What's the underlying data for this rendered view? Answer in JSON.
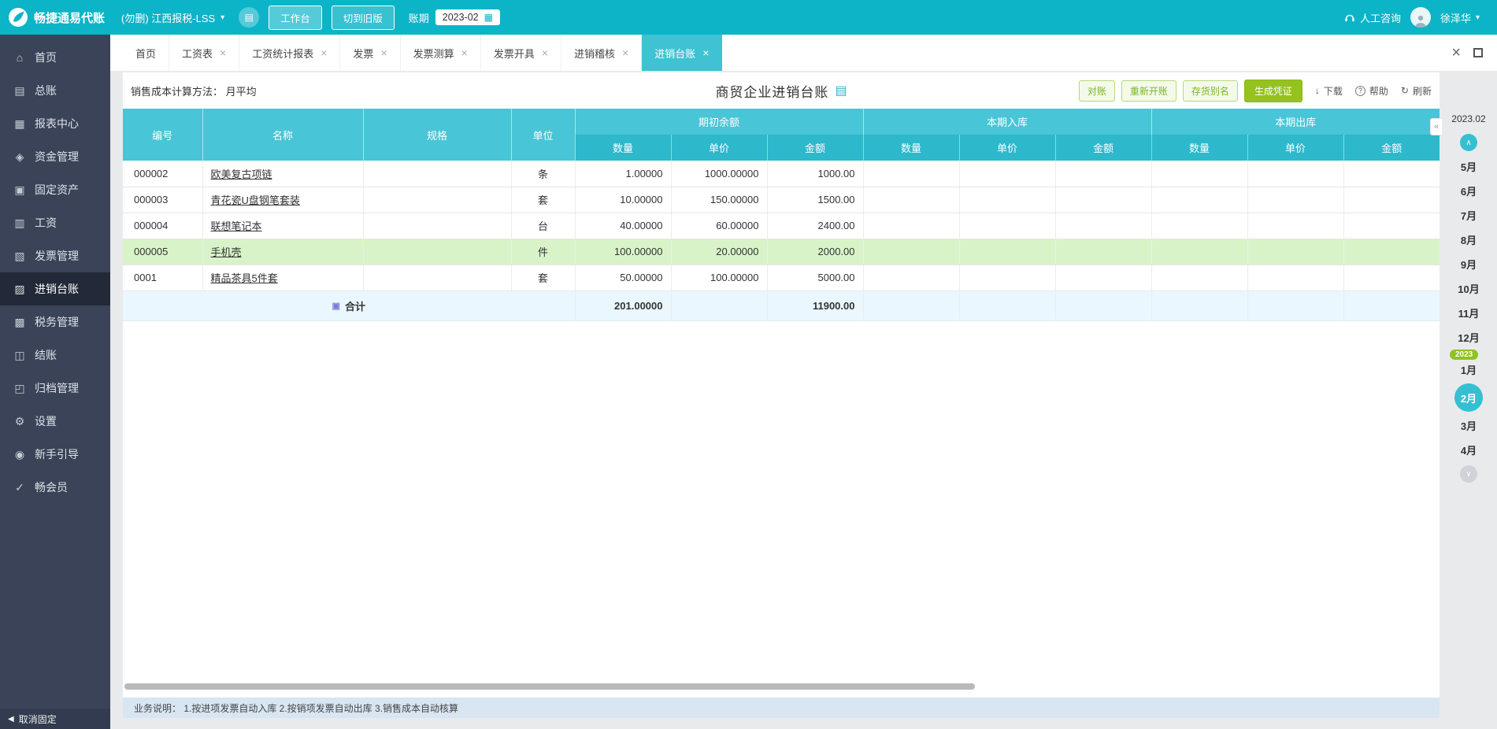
{
  "colors": {
    "accent_cyan": "#0cb4c7",
    "table_header_cyan": "#48c5d6",
    "table_subheader_cyan": "#2db8cc",
    "primary_green": "#95c21e",
    "highlight_row_green": "#d9f3c9",
    "total_row_blue": "#eaf7fe",
    "sidebar_dark": "#3a4357",
    "statusbar_blue": "#d8e5f2"
  },
  "topbar": {
    "logo_text": "畅捷通易代账",
    "company_select": "(勿删) 江西报税-LSS",
    "workbench_button": "工作台",
    "switch_old_button": "切到旧版",
    "period_label": "账期",
    "period_value": "2023-02",
    "consult_label": "人工咨询",
    "user_name": "徐泽华"
  },
  "sidebar": {
    "items": [
      {
        "id": "home",
        "label": "首页",
        "icon": "home-icon",
        "glyph": "⌂",
        "active": false
      },
      {
        "id": "general-ledger",
        "label": "总账",
        "icon": "ledger-icon",
        "glyph": "▤",
        "active": false
      },
      {
        "id": "report-center",
        "label": "报表中心",
        "icon": "report-icon",
        "glyph": "▦",
        "active": false
      },
      {
        "id": "funds",
        "label": "资金管理",
        "icon": "funds-icon",
        "glyph": "◈",
        "active": false
      },
      {
        "id": "fixed-assets",
        "label": "固定资产",
        "icon": "fixed-assets-icon",
        "glyph": "▣",
        "active": false
      },
      {
        "id": "payroll",
        "label": "工资",
        "icon": "payroll-icon",
        "glyph": "▥",
        "active": false
      },
      {
        "id": "invoice-mgmt",
        "label": "发票管理",
        "icon": "invoice-icon",
        "glyph": "▧",
        "active": false
      },
      {
        "id": "purchase-sale-ledger",
        "label": "进销台账",
        "icon": "inventory-ledger-icon",
        "glyph": "▨",
        "active": true
      },
      {
        "id": "tax-mgmt",
        "label": "税务管理",
        "icon": "tax-icon",
        "glyph": "▩",
        "active": false
      },
      {
        "id": "closing",
        "label": "结账",
        "icon": "closing-icon",
        "glyph": "◫",
        "active": false
      },
      {
        "id": "archive-mgmt",
        "label": "归档管理",
        "icon": "archive-icon",
        "glyph": "◰",
        "active": false
      },
      {
        "id": "settings",
        "label": "设置",
        "icon": "gear-icon",
        "glyph": "⚙",
        "active": false
      },
      {
        "id": "beginner-guide",
        "label": "新手引导",
        "icon": "guide-icon",
        "glyph": "◉",
        "active": false
      },
      {
        "id": "member",
        "label": "畅会员",
        "icon": "member-icon",
        "glyph": "✓",
        "active": false
      }
    ],
    "unpin_label": "取消固定"
  },
  "tabs": [
    {
      "id": "home",
      "label": "首页",
      "closable": false,
      "active": false
    },
    {
      "id": "payroll-sheet",
      "label": "工资表",
      "closable": true,
      "active": false
    },
    {
      "id": "payroll-stat-report",
      "label": "工资统计报表",
      "closable": true,
      "active": false
    },
    {
      "id": "invoice",
      "label": "发票",
      "closable": true,
      "active": false
    },
    {
      "id": "invoice-calc",
      "label": "发票测算",
      "closable": true,
      "active": false
    },
    {
      "id": "invoice-issue",
      "label": "发票开具",
      "closable": true,
      "active": false
    },
    {
      "id": "purchase-sale-audit",
      "label": "进销稽核",
      "closable": true,
      "active": false
    },
    {
      "id": "purchase-sale-ledger",
      "label": "进销台账",
      "closable": true,
      "active": true
    }
  ],
  "toolbar": {
    "cost_method_label": "销售成本计算方法：",
    "cost_method_value": "月平均",
    "page_title": "商贸企业进销台账",
    "buttons": [
      "对账",
      "重新开账",
      "存货别名"
    ],
    "primary_button": "生成凭证",
    "download_label": "下载",
    "help_label": "帮助",
    "refresh_label": "刷新"
  },
  "table": {
    "columns": [
      "编号",
      "名称",
      "规格",
      "单位"
    ],
    "groups": [
      "期初余额",
      "本期入库",
      "本期出库"
    ],
    "subcolumns": [
      "数量",
      "单价",
      "金额"
    ],
    "rows": [
      {
        "code": "000002",
        "name": "欧美复古项链",
        "spec": "",
        "unit": "条",
        "qty": "1.00000",
        "price": "1000.00000",
        "amount": "1000.00",
        "in_qty": "",
        "in_price": "",
        "in_amount": "",
        "out_qty": "",
        "out_price": "",
        "out_amount": "",
        "highlight": false
      },
      {
        "code": "000003",
        "name": "青花瓷U盘钢笔套装",
        "spec": "",
        "unit": "套",
        "qty": "10.00000",
        "price": "150.00000",
        "amount": "1500.00",
        "in_qty": "",
        "in_price": "",
        "in_amount": "",
        "out_qty": "",
        "out_price": "",
        "out_amount": "",
        "highlight": false
      },
      {
        "code": "000004",
        "name": "联想笔记本",
        "spec": "",
        "unit": "台",
        "qty": "40.00000",
        "price": "60.00000",
        "amount": "2400.00",
        "in_qty": "",
        "in_price": "",
        "in_amount": "",
        "out_qty": "",
        "out_price": "",
        "out_amount": "",
        "highlight": false
      },
      {
        "code": "000005",
        "name": "手机壳",
        "spec": "",
        "unit": "件",
        "qty": "100.00000",
        "price": "20.00000",
        "amount": "2000.00",
        "in_qty": "",
        "in_price": "",
        "in_amount": "",
        "out_qty": "",
        "out_price": "",
        "out_amount": "",
        "highlight": true
      },
      {
        "code": "0001",
        "name": "精品茶具5件套",
        "spec": "",
        "unit": "套",
        "qty": "50.00000",
        "price": "100.00000",
        "amount": "5000.00",
        "in_qty": "",
        "in_price": "",
        "in_amount": "",
        "out_qty": "",
        "out_price": "",
        "out_amount": "",
        "highlight": false
      }
    ],
    "total": {
      "label": "合计",
      "qty": "201.00000",
      "amount": "11900.00"
    }
  },
  "month_panel": {
    "current": "2023.02",
    "items": [
      {
        "label": "5月"
      },
      {
        "label": "6月"
      },
      {
        "label": "7月"
      },
      {
        "label": "8月"
      },
      {
        "label": "9月"
      },
      {
        "label": "10月"
      },
      {
        "label": "11月"
      },
      {
        "label": "12月"
      },
      {
        "label": "2023",
        "badge": true
      },
      {
        "label": "1月"
      },
      {
        "label": "2月",
        "active": true
      },
      {
        "label": "3月"
      },
      {
        "label": "4月"
      }
    ]
  },
  "statusbar": {
    "text": "业务说明：  1.按进项发票自动入库   2.按销项发票自动出库   3.销售成本自动核算"
  }
}
